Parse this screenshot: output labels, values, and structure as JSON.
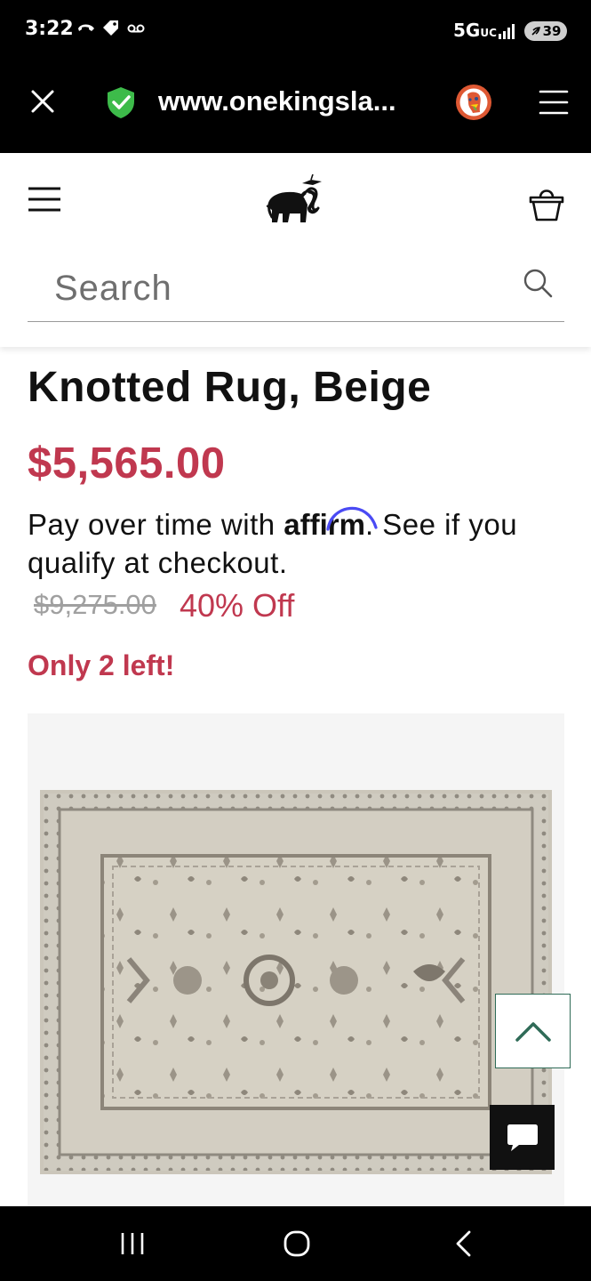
{
  "status_bar": {
    "time": "3:22",
    "network": "5G",
    "network_sub": "UC",
    "battery": "39",
    "icons": [
      "call-forward-icon",
      "tag-icon",
      "voicemail-icon",
      "signal-icon",
      "battery-icon"
    ]
  },
  "browser": {
    "url": "www.onekingsla...",
    "icons": [
      "close-icon",
      "shield-check-icon",
      "duckduckgo-icon",
      "menu-icon"
    ]
  },
  "site_header": {
    "search_placeholder": "Search",
    "icons": [
      "hamburger-icon",
      "elephant-logo-icon",
      "shopping-basket-icon",
      "search-icon"
    ]
  },
  "product": {
    "title": "Knotted Rug, Beige",
    "price": "$5,565.00",
    "affirm_prefix": "Pay over time with ",
    "affirm_brand": "affirm",
    "affirm_suffix": ". See if you qualify at checkout.",
    "was_price": "$9,275.00",
    "discount": "40% Off",
    "stock_message": "Only 2 left!"
  },
  "colors": {
    "accent_red": "#c0384f",
    "affirm_blue": "#4a4af4",
    "shield_green": "#3dbb4a",
    "scroll_button_border": "#2f6b57"
  },
  "floating": {
    "icons": [
      "chevron-up-icon",
      "chat-bubble-icon"
    ]
  },
  "nav_bar": {
    "icons": [
      "recents-icon",
      "home-icon",
      "back-icon"
    ]
  }
}
